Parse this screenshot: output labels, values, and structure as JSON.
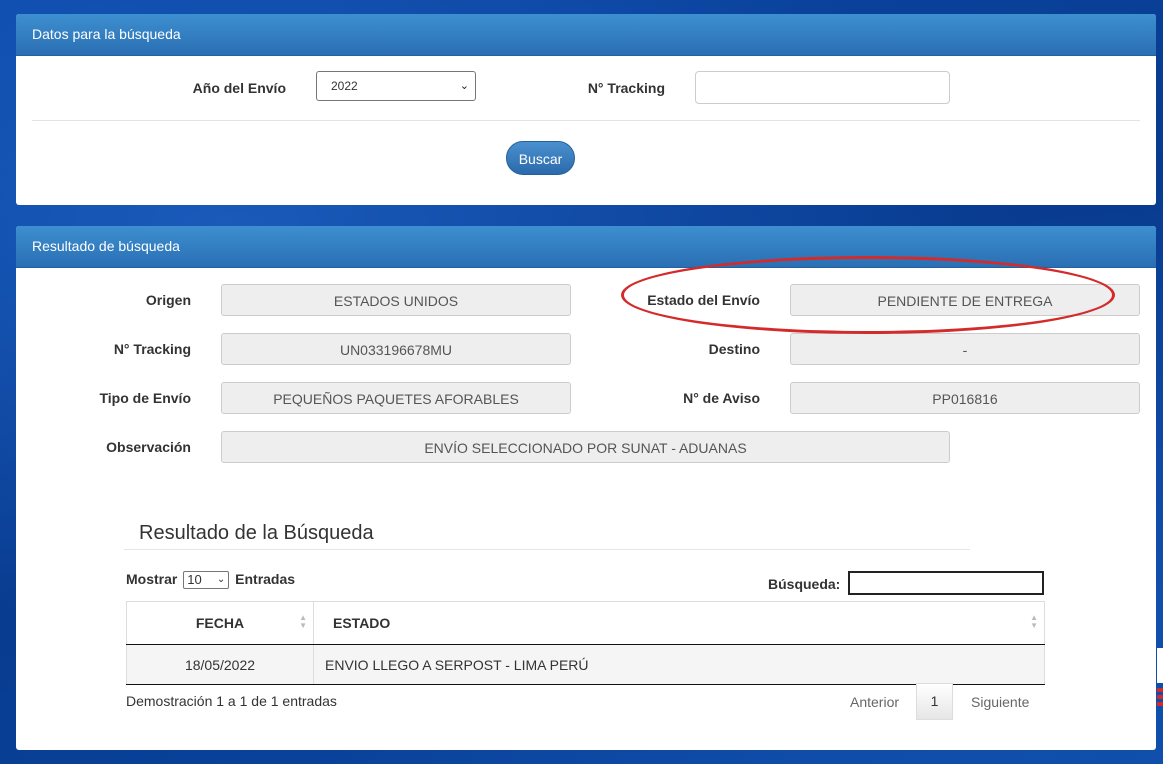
{
  "search_panel": {
    "title": "Datos para la búsqueda",
    "year_label": "Año del Envío",
    "year_value": "2022",
    "tracking_label": "N° Tracking",
    "tracking_value": "",
    "search_button": "Buscar"
  },
  "result_panel": {
    "title": "Resultado de búsqueda",
    "fields": {
      "origen_label": "Origen",
      "origen_value": "ESTADOS UNIDOS",
      "estado_label": "Estado del Envío",
      "estado_value": "PENDIENTE DE ENTREGA",
      "tracking_label": "N° Tracking",
      "tracking_value": "UN033196678MU",
      "destino_label": "Destino",
      "destino_value": "-",
      "tipo_label": "Tipo de Envío",
      "tipo_value": "PEQUEÑOS PAQUETES AFORABLES",
      "aviso_label": "N° de Aviso",
      "aviso_value": "PP016816",
      "obs_label": "Observación",
      "obs_value": "ENVÍO SELECCIONADO POR SUNAT - ADUANAS"
    },
    "highlight_color": "#d42a2a"
  },
  "history": {
    "title": "Resultado de la Búsqueda",
    "show_label": "Mostrar",
    "page_size": "10",
    "entries_label": "Entradas",
    "search_label": "Búsqueda:",
    "search_value": "",
    "columns": [
      "FECHA",
      "ESTADO"
    ],
    "rows": [
      {
        "fecha": "18/05/2022",
        "estado": "ENVIO LLEGO A SERPOST - LIMA PERÚ"
      }
    ],
    "info": "Demostración 1 a 1 de 1 entradas",
    "prev": "Anterior",
    "current_page": "1",
    "next": "Siguiente"
  },
  "colors": {
    "header_blue": "#2a6fb3",
    "background_blue": "#0a3f95",
    "button_blue": "#2b6aab"
  }
}
